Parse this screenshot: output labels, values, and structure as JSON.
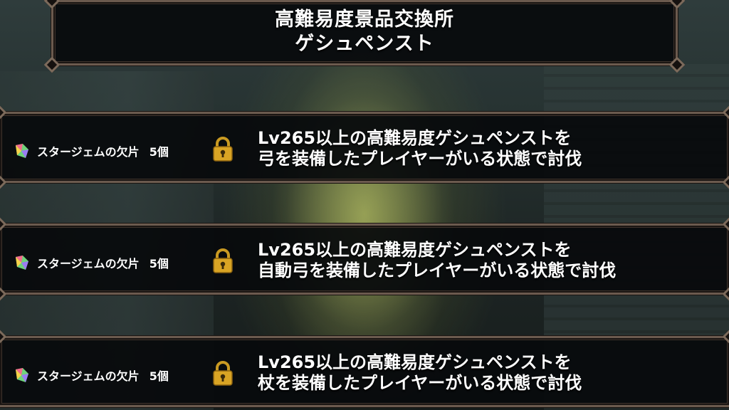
{
  "header": {
    "title_line1": "高難易度景品交換所",
    "title_line2": "ゲシュペンスト"
  },
  "rewards": [
    {
      "item_name": "スタージェムの欠片",
      "count": "5個",
      "icon": "star-gem-fragment-icon",
      "locked": true,
      "condition_line1": "Lv265以上の高難易度ゲシュペンストを",
      "condition_line2": "弓を装備したプレイヤーがいる状態で討伐"
    },
    {
      "item_name": "スタージェムの欠片",
      "count": "5個",
      "icon": "star-gem-fragment-icon",
      "locked": true,
      "condition_line1": "Lv265以上の高難易度ゲシュペンストを",
      "condition_line2": "自動弓を装備したプレイヤーがいる状態で討伐"
    },
    {
      "item_name": "スタージェムの欠片",
      "count": "5個",
      "icon": "star-gem-fragment-icon",
      "locked": true,
      "condition_line1": "Lv265以上の高難易度ゲシュペンストを",
      "condition_line2": "杖を装備したプレイヤーがいる状態で討伐"
    }
  ],
  "colors": {
    "frame_border": "#6b5a4e",
    "panel_bg": "#080a0c",
    "lock_gold": "#d9a424",
    "glow": "#bec85a"
  }
}
